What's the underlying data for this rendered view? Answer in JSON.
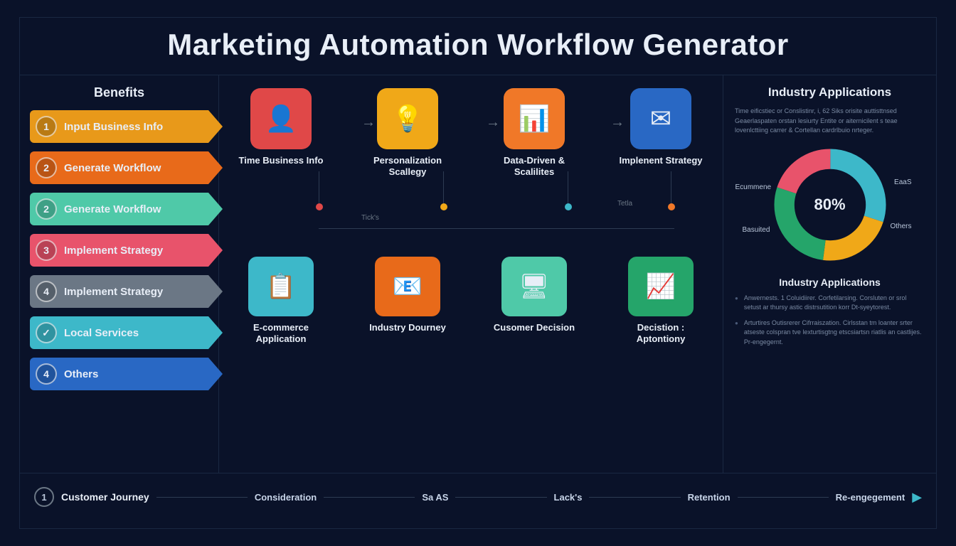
{
  "title": "Marketing Automation Workflow Generator",
  "left": {
    "heading": "Benefits",
    "steps": [
      {
        "num": "1",
        "label": "Input Business Info"
      },
      {
        "num": "2",
        "label": "Generate Workflow"
      },
      {
        "num": "2",
        "label": "Generate Workflow"
      },
      {
        "num": "3",
        "label": "Implement Strategy"
      },
      {
        "num": "4",
        "label": "Implement Strategy"
      },
      {
        "num": "✓",
        "label": "Local Services"
      },
      {
        "num": "4",
        "label": "Others"
      }
    ]
  },
  "mid": {
    "rowA": [
      {
        "label": "Time Business Info",
        "icon": "👤"
      },
      {
        "label": "Personalization Scallegy",
        "icon": "💡"
      },
      {
        "label": "Data-Driven & Scalilites",
        "icon": "📊"
      },
      {
        "label": "Implenent Strategy",
        "icon": "✉"
      }
    ],
    "rowB": [
      {
        "label": "E-commerce Application",
        "icon": "📋"
      },
      {
        "label": "Industry Dourney",
        "icon": "📧"
      },
      {
        "label": "Cusomer Decision",
        "icon": "🖥"
      },
      {
        "label": "Decistion : Aptontiony",
        "icon": "📈"
      }
    ],
    "small1": "Tick's",
    "small2": "Tetla"
  },
  "right": {
    "heading": "Industry Applications",
    "blurb": "Time eificstiec or Conslistinr, i, 62 Siks orisite auttisttnsed Geaerlaspaten orstan lesiurty Entite or aiternicilent s teae lovenlcttiing carrer & Cortellan cardrlbuio nrteger.",
    "chart_title": "Industry Applications",
    "labels": {
      "l1": "Ecummene",
      "l2": "Basuited",
      "l3": "EaaS",
      "l4": "Others"
    },
    "center": "80%",
    "bul1": "Anwernests. 1 Coluidiirer. Corfetilarsing. Corsluten or srol setust ar thursy astic distrsutition korr Dt-syeytorest.",
    "bul2": "Arturtires Outisrerer Cifrraiszation. Cirlsstan tm loanter srter atseste colspran tve lexturtisgtng etscsiartsn riatlis an castlijes. Pr-engegernt."
  },
  "footer": {
    "num": "1",
    "stage": "Customer Journey",
    "items": [
      "Consideration",
      "Sa AS",
      "Lack's",
      "Retention",
      "Re-engegement"
    ]
  },
  "chart_data": {
    "type": "pie",
    "title": "Industry Applications",
    "categories": [
      "Ecummene",
      "EaaS",
      "Others",
      "Basuited"
    ],
    "values": [
      30,
      22,
      28,
      20
    ],
    "colors": [
      "#3db8c9",
      "#f0a818",
      "#25a56a",
      "#e8536b"
    ],
    "center_label": "80%"
  }
}
